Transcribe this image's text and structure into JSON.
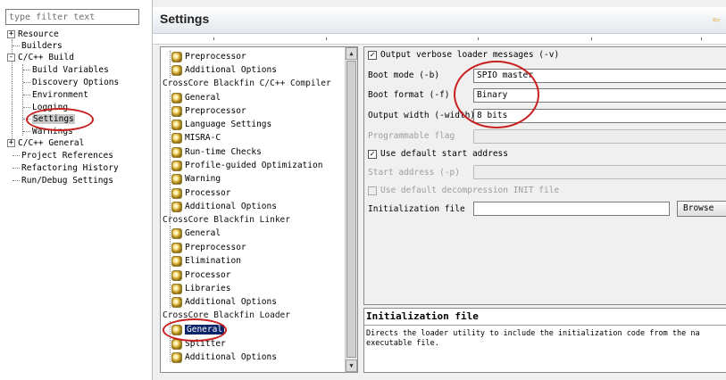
{
  "filter": {
    "placeholder": "type filter text"
  },
  "nav": {
    "items": [
      {
        "label": "Resource",
        "expander": "+"
      },
      {
        "label": "Builders"
      },
      {
        "label": "C/C++ Build",
        "expander": "-"
      },
      {
        "label": "Build Variables"
      },
      {
        "label": "Discovery Options"
      },
      {
        "label": "Environment"
      },
      {
        "label": "Logging"
      },
      {
        "label": "Settings"
      },
      {
        "label": "Warnings"
      },
      {
        "label": "C/C++ General",
        "expander": "+"
      },
      {
        "label": "Project References"
      },
      {
        "label": "Refactoring History"
      },
      {
        "label": "Run/Debug Settings"
      }
    ]
  },
  "settings": {
    "title": "Settings",
    "back_icon": "back-arrow-icon"
  },
  "tool_tree": {
    "items": [
      {
        "label": "Preprocessor"
      },
      {
        "label": "Additional Options"
      },
      {
        "label": "CrossCore Blackfin C/C++ Compiler",
        "top": true
      },
      {
        "label": "General"
      },
      {
        "label": "Preprocessor"
      },
      {
        "label": "Language Settings"
      },
      {
        "label": "MISRA-C"
      },
      {
        "label": "Run-time Checks"
      },
      {
        "label": "Profile-guided Optimization"
      },
      {
        "label": "Warning"
      },
      {
        "label": "Processor"
      },
      {
        "label": "Additional Options"
      },
      {
        "label": "CrossCore Blackfin Linker",
        "top": true
      },
      {
        "label": "General"
      },
      {
        "label": "Preprocessor"
      },
      {
        "label": "Elimination"
      },
      {
        "label": "Processor"
      },
      {
        "label": "Libraries"
      },
      {
        "label": "Additional Options"
      },
      {
        "label": "CrossCore Blackfin Loader",
        "top": true
      },
      {
        "label": "General",
        "selected": true
      },
      {
        "label": "Splitter"
      },
      {
        "label": "Additional Options"
      }
    ]
  },
  "options": {
    "verbose_label": "Output verbose loader messages (-v)",
    "verbose_checked": true,
    "boot_mode_label": "Boot mode (-b)",
    "boot_mode_value": "SPIO master",
    "boot_format_label": "Boot format (-f)",
    "boot_format_value": "Binary",
    "output_width_label": "Output width (-width)",
    "output_width_value": "8 bits",
    "programmable_flag_label": "Programmable flag",
    "default_start_label": "Use default start address",
    "default_start_checked": true,
    "start_address_label": "Start address (-p)",
    "default_decomp_label": "Use default decompression INIT file",
    "init_file_label": "Initialization file",
    "init_file_value": "",
    "browse_label": "Browse"
  },
  "help": {
    "title": "Initialization file",
    "text": "Directs the loader utility to include the initialization code from the na executable file."
  },
  "colors": {
    "annotation_circle": "#c82020",
    "selection_bg": "#0a246a"
  }
}
